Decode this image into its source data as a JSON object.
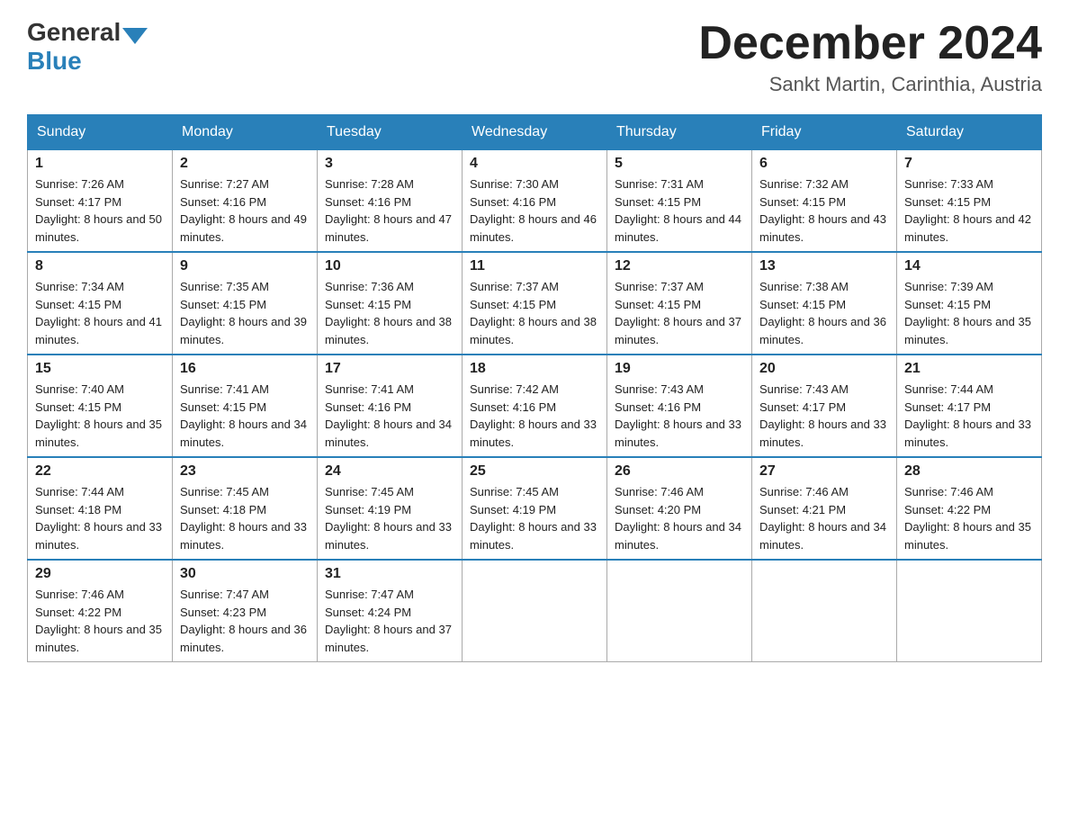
{
  "logo": {
    "general": "General",
    "blue": "Blue"
  },
  "title": "December 2024",
  "location": "Sankt Martin, Carinthia, Austria",
  "days_of_week": [
    "Sunday",
    "Monday",
    "Tuesday",
    "Wednesday",
    "Thursday",
    "Friday",
    "Saturday"
  ],
  "weeks": [
    [
      {
        "day": "1",
        "sunrise": "7:26 AM",
        "sunset": "4:17 PM",
        "daylight": "8 hours and 50 minutes."
      },
      {
        "day": "2",
        "sunrise": "7:27 AM",
        "sunset": "4:16 PM",
        "daylight": "8 hours and 49 minutes."
      },
      {
        "day": "3",
        "sunrise": "7:28 AM",
        "sunset": "4:16 PM",
        "daylight": "8 hours and 47 minutes."
      },
      {
        "day": "4",
        "sunrise": "7:30 AM",
        "sunset": "4:16 PM",
        "daylight": "8 hours and 46 minutes."
      },
      {
        "day": "5",
        "sunrise": "7:31 AM",
        "sunset": "4:15 PM",
        "daylight": "8 hours and 44 minutes."
      },
      {
        "day": "6",
        "sunrise": "7:32 AM",
        "sunset": "4:15 PM",
        "daylight": "8 hours and 43 minutes."
      },
      {
        "day": "7",
        "sunrise": "7:33 AM",
        "sunset": "4:15 PM",
        "daylight": "8 hours and 42 minutes."
      }
    ],
    [
      {
        "day": "8",
        "sunrise": "7:34 AM",
        "sunset": "4:15 PM",
        "daylight": "8 hours and 41 minutes."
      },
      {
        "day": "9",
        "sunrise": "7:35 AM",
        "sunset": "4:15 PM",
        "daylight": "8 hours and 39 minutes."
      },
      {
        "day": "10",
        "sunrise": "7:36 AM",
        "sunset": "4:15 PM",
        "daylight": "8 hours and 38 minutes."
      },
      {
        "day": "11",
        "sunrise": "7:37 AM",
        "sunset": "4:15 PM",
        "daylight": "8 hours and 38 minutes."
      },
      {
        "day": "12",
        "sunrise": "7:37 AM",
        "sunset": "4:15 PM",
        "daylight": "8 hours and 37 minutes."
      },
      {
        "day": "13",
        "sunrise": "7:38 AM",
        "sunset": "4:15 PM",
        "daylight": "8 hours and 36 minutes."
      },
      {
        "day": "14",
        "sunrise": "7:39 AM",
        "sunset": "4:15 PM",
        "daylight": "8 hours and 35 minutes."
      }
    ],
    [
      {
        "day": "15",
        "sunrise": "7:40 AM",
        "sunset": "4:15 PM",
        "daylight": "8 hours and 35 minutes."
      },
      {
        "day": "16",
        "sunrise": "7:41 AM",
        "sunset": "4:15 PM",
        "daylight": "8 hours and 34 minutes."
      },
      {
        "day": "17",
        "sunrise": "7:41 AM",
        "sunset": "4:16 PM",
        "daylight": "8 hours and 34 minutes."
      },
      {
        "day": "18",
        "sunrise": "7:42 AM",
        "sunset": "4:16 PM",
        "daylight": "8 hours and 33 minutes."
      },
      {
        "day": "19",
        "sunrise": "7:43 AM",
        "sunset": "4:16 PM",
        "daylight": "8 hours and 33 minutes."
      },
      {
        "day": "20",
        "sunrise": "7:43 AM",
        "sunset": "4:17 PM",
        "daylight": "8 hours and 33 minutes."
      },
      {
        "day": "21",
        "sunrise": "7:44 AM",
        "sunset": "4:17 PM",
        "daylight": "8 hours and 33 minutes."
      }
    ],
    [
      {
        "day": "22",
        "sunrise": "7:44 AM",
        "sunset": "4:18 PM",
        "daylight": "8 hours and 33 minutes."
      },
      {
        "day": "23",
        "sunrise": "7:45 AM",
        "sunset": "4:18 PM",
        "daylight": "8 hours and 33 minutes."
      },
      {
        "day": "24",
        "sunrise": "7:45 AM",
        "sunset": "4:19 PM",
        "daylight": "8 hours and 33 minutes."
      },
      {
        "day": "25",
        "sunrise": "7:45 AM",
        "sunset": "4:19 PM",
        "daylight": "8 hours and 33 minutes."
      },
      {
        "day": "26",
        "sunrise": "7:46 AM",
        "sunset": "4:20 PM",
        "daylight": "8 hours and 34 minutes."
      },
      {
        "day": "27",
        "sunrise": "7:46 AM",
        "sunset": "4:21 PM",
        "daylight": "8 hours and 34 minutes."
      },
      {
        "day": "28",
        "sunrise": "7:46 AM",
        "sunset": "4:22 PM",
        "daylight": "8 hours and 35 minutes."
      }
    ],
    [
      {
        "day": "29",
        "sunrise": "7:46 AM",
        "sunset": "4:22 PM",
        "daylight": "8 hours and 35 minutes."
      },
      {
        "day": "30",
        "sunrise": "7:47 AM",
        "sunset": "4:23 PM",
        "daylight": "8 hours and 36 minutes."
      },
      {
        "day": "31",
        "sunrise": "7:47 AM",
        "sunset": "4:24 PM",
        "daylight": "8 hours and 37 minutes."
      },
      null,
      null,
      null,
      null
    ]
  ]
}
